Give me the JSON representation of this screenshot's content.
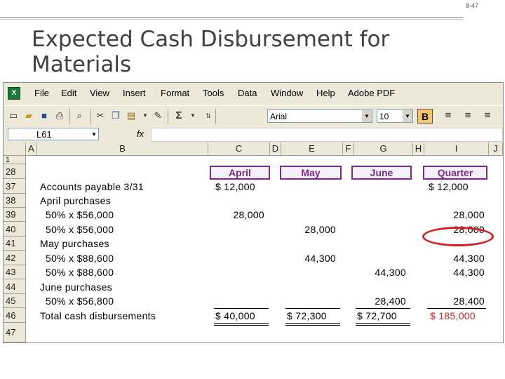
{
  "slide": {
    "page_number": "8-47",
    "title": "Expected Cash Disbursement for Materials"
  },
  "menus": [
    "File",
    "Edit",
    "View",
    "Insert",
    "Format",
    "Tools",
    "Data",
    "Window",
    "Help",
    "Adobe PDF"
  ],
  "toolbar": {
    "font": "Arial",
    "size": "10",
    "bold_label": "B",
    "sum_label": "Σ"
  },
  "formula_bar": {
    "name_box": "L61",
    "fx": "fx"
  },
  "columns": [
    "A",
    "B",
    "C",
    "D",
    "E",
    "F",
    "G",
    "H",
    "I",
    "J"
  ],
  "rows": [
    "1",
    "28",
    "37",
    "38",
    "39",
    "40",
    "41",
    "42",
    "43",
    "44",
    "45",
    "46",
    "47"
  ],
  "headers": {
    "april": "April",
    "may": "May",
    "june": "June",
    "quarter": "Quarter"
  },
  "labels": {
    "r37": "Accounts payable 3/31",
    "r38": "April purchases",
    "r39": "50% x $56,000",
    "r40": "50% x $56,000",
    "r41": "May purchases",
    "r42": "50% x $88,600",
    "r43": "50% x $88,600",
    "r44": "June purchases",
    "r45": "50% x $56,800",
    "r46": "Total cash disbursements"
  },
  "values": {
    "c37": "$   12,000",
    "i37": "$      12,000",
    "c39": "28,000",
    "i39": "28,000",
    "e40": "28,000",
    "i40": "28,000",
    "e42": "44,300",
    "i42": "44,300",
    "g43": "44,300",
    "i43": "44,300",
    "g45": "28,400",
    "i45": "28,400",
    "c46": "$   40,000",
    "e46": "$   72,300",
    "g46": "$   72,700",
    "i46": "$   185,000"
  },
  "colors": {
    "header_purple": "#7a2a8a",
    "highlight_red": "#d42020"
  }
}
